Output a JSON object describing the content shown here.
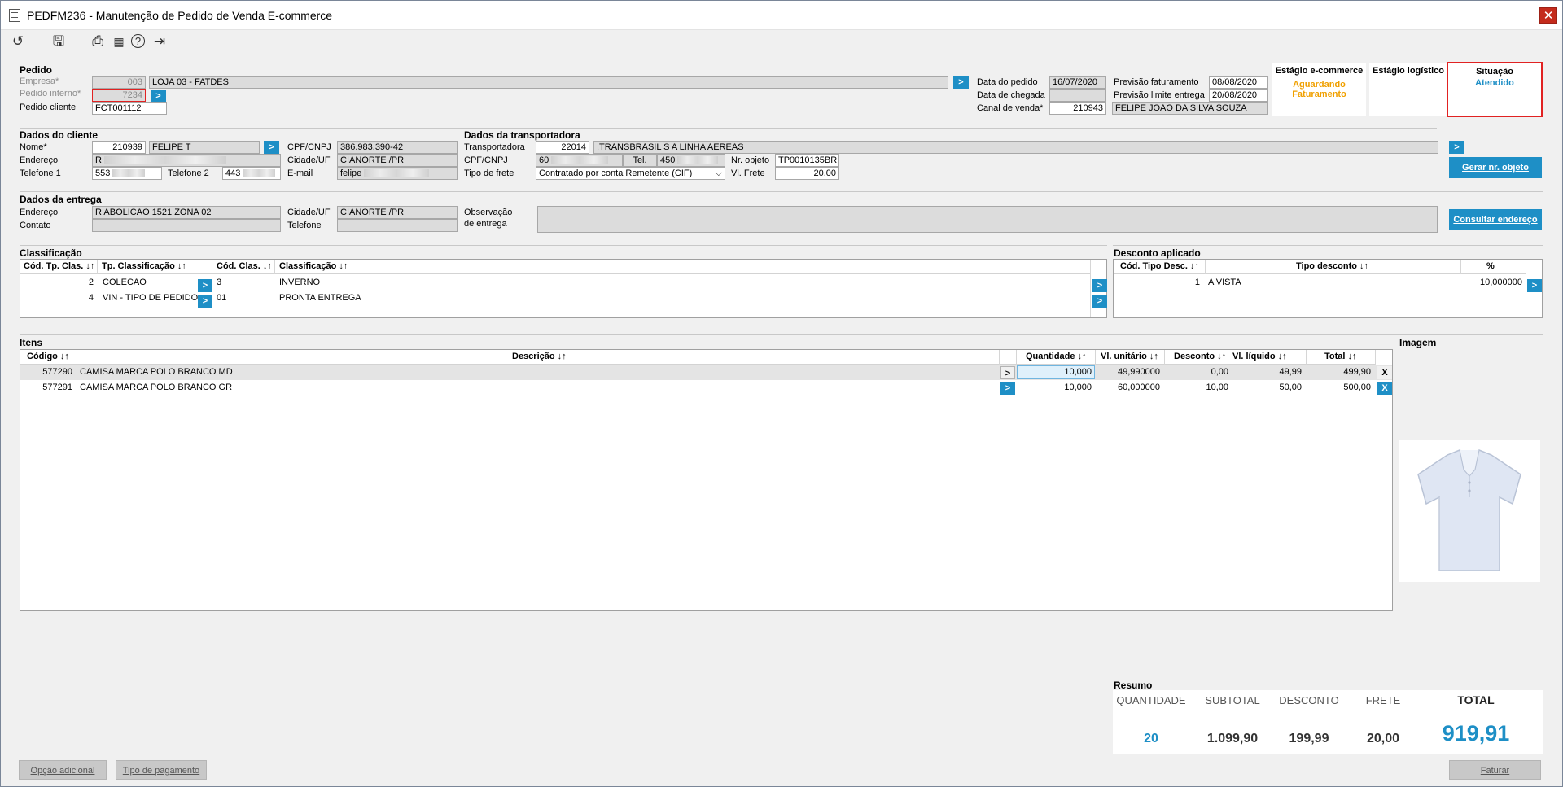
{
  "window": {
    "title": "PEDFM236 - Manutenção de Pedido de Venda E-commerce",
    "close": "✕"
  },
  "toolbar": {
    "icons": [
      "undo-icon",
      "save-icon",
      "print-icon",
      "calendar-icon",
      "help-icon",
      "exit-icon"
    ],
    "glyphs": {
      "undo": "↺",
      "save": "🖫",
      "print": "⎙",
      "calendar": "▦",
      "help": "?",
      "exit": "⇥"
    }
  },
  "pedido": {
    "title": "Pedido",
    "empresa_label": "Empresa*",
    "empresa_code": "003",
    "empresa_name": "LOJA 03 - FATDES",
    "interno_label": "Pedido interno*",
    "interno_value": "7234",
    "cliente_label": "Pedido cliente",
    "cliente_value": "FCT001112",
    "data_pedido_label": "Data do pedido",
    "data_pedido": "16/07/2020",
    "data_chegada_label": "Data de chegada",
    "data_chegada": "",
    "canal_label": "Canal de venda*",
    "canal_code": "210943",
    "canal_name": "FELIPE JOAO DA SILVA SOUZA",
    "prev_fat_label": "Previsão faturamento",
    "prev_fat": "08/08/2020",
    "prev_lim_label": "Previsão limite entrega",
    "prev_lim": "20/08/2020"
  },
  "stages": {
    "ecommerce_label": "Estágio e-commerce",
    "ecommerce_value_1": "Aguardando",
    "ecommerce_value_2": "Faturamento",
    "logistico_label": "Estágio logístico",
    "logistico_value": "",
    "situacao_label": "Situação",
    "situacao_value": "Atendido",
    "colors": {
      "orange": "#f0a000",
      "blue": "#1e8fc6",
      "red": "#e12222"
    }
  },
  "cliente": {
    "title": "Dados do cliente",
    "nome_label": "Nome*",
    "nome_code": "210939",
    "nome_name": "FELIPE T",
    "endereco_label": "Endereço",
    "endereco_value": "R",
    "tel1_label": "Telefone 1",
    "tel1_value": "553",
    "tel2_label": "Telefone 2",
    "tel2_value": "443",
    "cpf_label": "CPF/CNPJ",
    "cpf_value": "386.983.390-42",
    "cidade_label": "Cidade/UF",
    "cidade_value": "CIANORTE /PR",
    "email_label": "E-mail",
    "email_value": "felipe"
  },
  "transportadora": {
    "title": "Dados da transportadora",
    "transp_label": "Transportadora",
    "transp_code": "22014",
    "transp_name": ".TRANSBRASIL S A LINHA AEREAS",
    "cpf_label": "CPF/CNPJ",
    "cpf_value": "60",
    "tel_label": "Tel.",
    "tel_value": "450",
    "nr_obj_label": "Nr. objeto",
    "nr_obj_value": "TP0010135BR",
    "frete_tipo_label": "Tipo de frete",
    "frete_tipo_value": "Contratado por conta Remetente (CIF)",
    "vl_frete_label": "Vl. Frete",
    "vl_frete_value": "20,00",
    "gerar_button": "Gerar nr. objeto"
  },
  "entrega": {
    "title": "Dados da entrega",
    "endereco_label": "Endereço",
    "endereco_value": "R ABOLICAO 1521  ZONA 02",
    "contato_label": "Contato",
    "contato_value": "",
    "cidade_label": "Cidade/UF",
    "cidade_value": "CIANORTE /PR",
    "telefone_label": "Telefone",
    "telefone_value": "",
    "obs_label_1": "Observação",
    "obs_label_2": "de entrega",
    "obs_value": "",
    "consultar_button": "Consultar endereço"
  },
  "classificacao": {
    "title": "Classificação",
    "headers": [
      "Cód. Tp. Clas. ↓↑",
      "Tp. Classificação ↓↑",
      "Cód. Clas. ↓↑",
      "Classificação ↓↑"
    ],
    "rows": [
      {
        "cod_tp": "2",
        "tp": "COLECAO",
        "cod": "3",
        "clas": "INVERNO"
      },
      {
        "cod_tp": "4",
        "tp": "VIN - TIPO DE PEDIDO",
        "cod": "01",
        "clas": "PRONTA ENTREGA"
      }
    ]
  },
  "desconto": {
    "title": "Desconto aplicado",
    "headers": [
      "Cód. Tipo Desc. ↓↑",
      "Tipo desconto ↓↑",
      "%"
    ],
    "rows": [
      {
        "cod": "1",
        "tipo": "A VISTA",
        "pct": "10,000000"
      }
    ]
  },
  "itens": {
    "title": "Itens",
    "headers": [
      "Código ↓↑",
      "Descrição ↓↑",
      "Quantidade ↓↑",
      "Vl. unitário ↓↑",
      "Desconto ↓↑",
      "Vl. líquido ↓↑",
      "Total ↓↑"
    ],
    "rows": [
      {
        "codigo": "577290",
        "descricao": "CAMISA MARCA POLO BRANCO MD",
        "qtd": "10,000",
        "vl_unit": "49,990000",
        "desconto": "0,00",
        "vl_liq": "49,99",
        "total": "499,90"
      },
      {
        "codigo": "577291",
        "descricao": "CAMISA MARCA POLO BRANCO GR",
        "qtd": "10,000",
        "vl_unit": "60,000000",
        "desconto": "10,00",
        "vl_liq": "50,00",
        "total": "500,00"
      }
    ],
    "arrow": ">",
    "remove": "X"
  },
  "imagem": {
    "title": "Imagem"
  },
  "resumo": {
    "title": "Resumo",
    "labels": {
      "quantidade": "QUANTIDADE",
      "subtotal": "SUBTOTAL",
      "desconto": "DESCONTO",
      "frete": "FRETE",
      "total": "TOTAL"
    },
    "values": {
      "quantidade": "20",
      "subtotal": "1.099,90",
      "desconto": "199,99",
      "frete": "20,00",
      "total": "919,91"
    }
  },
  "footer": {
    "opcao_button": "Opção adicional",
    "pagamento_button": "Tipo de pagamento",
    "faturar_button": "Faturar"
  }
}
